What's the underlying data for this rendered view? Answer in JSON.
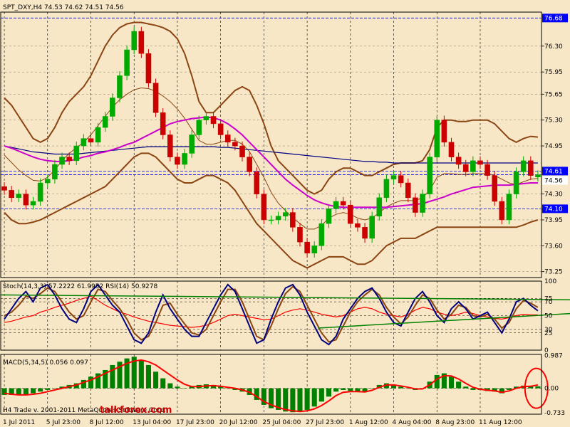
{
  "header": {
    "title": "SPT_DXY,H4  74.53 74.62 74.51 74.56",
    "stoch_label": "Stoch(14,3,3) 57.2222 61.9952  RSI(14) 50.9278",
    "macd_label": "MACD(5,34,5) 0.056 0.097",
    "copyright": "H4 Trade v. 2001-2011 MetaQuotes Software Corp.",
    "watermark": "talkforex.com"
  },
  "colors": {
    "background": "#f7e7c6",
    "frame": "#000000",
    "grid": "#000000",
    "up_candle": "#00aa00",
    "down_candle": "#cc0000",
    "bollinger": "#8b4513",
    "ma_slow": "#cc00cc",
    "ma_long": "#000080",
    "stoch_main": "#000080",
    "stoch_signal": "#8b4513",
    "rsi": "#ff0000",
    "trendline": "#008000",
    "macd_hist": "#008000",
    "macd_signal": "#ff0000",
    "price_tag": "#0000ff"
  },
  "chart_data": [
    {
      "type": "candlestick",
      "title": "SPT_DXY,H4",
      "ohlc_last": {
        "open": 74.53,
        "high": 74.62,
        "low": 74.51,
        "close": 74.56
      },
      "ylim": [
        73.17,
        76.76
      ],
      "y_ticks": [
        76.3,
        75.95,
        75.65,
        75.3,
        74.95,
        74.3,
        73.95,
        73.6,
        73.25
      ],
      "x_ticks": [
        "1 Jul 2011",
        "5 Jul 23:00",
        "8 Jul 12:00",
        "13 Jul 04:00",
        "17 Jul 23:00",
        "20 Jul 12:00",
        "25 Jul 04:00",
        "27 Jul 23:00",
        "1 Aug 12:00",
        "4 Aug 04:00",
        "8 Aug 23:00",
        "11 Aug 12:00"
      ],
      "price_tags": [
        {
          "value": "76.68"
        },
        {
          "value": "74.61"
        },
        {
          "value": "74.56"
        },
        {
          "value": "74.10"
        }
      ],
      "close": [
        74.35,
        74.25,
        74.3,
        74.15,
        74.2,
        74.45,
        74.5,
        74.7,
        74.8,
        74.75,
        74.95,
        75.05,
        75.0,
        75.2,
        75.35,
        75.6,
        75.9,
        76.25,
        76.5,
        76.2,
        75.8,
        75.4,
        75.1,
        74.8,
        74.7,
        74.85,
        75.1,
        75.3,
        75.35,
        75.25,
        75.1,
        75.0,
        74.95,
        74.8,
        74.6,
        74.3,
        73.95,
        73.95,
        74.0,
        74.05,
        73.85,
        73.65,
        73.5,
        73.6,
        73.9,
        74.1,
        74.2,
        74.15,
        73.9,
        73.85,
        73.7,
        74.0,
        74.25,
        74.5,
        74.55,
        74.45,
        74.25,
        74.05,
        74.3,
        74.8,
        75.3,
        75.0,
        74.8,
        74.7,
        74.6,
        74.75,
        74.7,
        74.55,
        74.2,
        73.95,
        74.3,
        74.6,
        74.75,
        74.55,
        74.56
      ],
      "open": [
        74.4,
        74.35,
        74.25,
        74.3,
        74.15,
        74.2,
        74.45,
        74.5,
        74.7,
        74.8,
        74.75,
        74.95,
        75.05,
        75.0,
        75.2,
        75.35,
        75.6,
        75.9,
        76.25,
        76.5,
        76.2,
        75.8,
        75.4,
        75.1,
        74.8,
        74.7,
        74.85,
        75.1,
        75.3,
        75.35,
        75.25,
        75.1,
        75.0,
        74.95,
        74.8,
        74.6,
        74.3,
        73.95,
        73.95,
        74.0,
        74.05,
        73.85,
        73.65,
        73.5,
        73.6,
        73.9,
        74.1,
        74.2,
        74.15,
        73.9,
        73.85,
        73.7,
        74.0,
        74.25,
        74.5,
        74.55,
        74.45,
        74.25,
        74.05,
        74.3,
        74.8,
        75.3,
        75.0,
        74.8,
        74.7,
        74.6,
        74.75,
        74.7,
        74.55,
        74.2,
        73.95,
        74.3,
        74.6,
        74.75,
        74.53
      ],
      "bb_upper": [
        75.6,
        75.5,
        75.35,
        75.2,
        75.05,
        75.0,
        75.05,
        75.2,
        75.4,
        75.55,
        75.65,
        75.75,
        75.9,
        76.1,
        76.3,
        76.45,
        76.55,
        76.6,
        76.62,
        76.62,
        76.6,
        76.58,
        76.55,
        76.5,
        76.4,
        76.2,
        75.9,
        75.55,
        75.4,
        75.4,
        75.5,
        75.6,
        75.7,
        75.75,
        75.7,
        75.5,
        75.25,
        74.95,
        74.75,
        74.65,
        74.55,
        74.45,
        74.35,
        74.3,
        74.35,
        74.5,
        74.6,
        74.65,
        74.65,
        74.6,
        74.55,
        74.55,
        74.6,
        74.65,
        74.7,
        74.72,
        74.72,
        74.72,
        74.75,
        74.9,
        75.2,
        75.3,
        75.3,
        75.28,
        75.28,
        75.3,
        75.3,
        75.3,
        75.25,
        75.15,
        75.05,
        75.0,
        75.05,
        75.08,
        75.07
      ],
      "bb_lower": [
        74.05,
        73.95,
        73.9,
        73.9,
        73.92,
        73.95,
        74.0,
        74.05,
        74.1,
        74.15,
        74.2,
        74.25,
        74.3,
        74.35,
        74.4,
        74.5,
        74.6,
        74.7,
        74.8,
        74.85,
        74.85,
        74.8,
        74.7,
        74.6,
        74.5,
        74.45,
        74.45,
        74.5,
        74.55,
        74.55,
        74.5,
        74.45,
        74.35,
        74.2,
        74.05,
        73.9,
        73.8,
        73.7,
        73.6,
        73.5,
        73.4,
        73.35,
        73.3,
        73.35,
        73.4,
        73.45,
        73.45,
        73.45,
        73.4,
        73.35,
        73.35,
        73.4,
        73.5,
        73.6,
        73.65,
        73.7,
        73.7,
        73.7,
        73.75,
        73.8,
        73.85,
        73.85,
        73.85,
        73.85,
        73.85,
        73.85,
        73.85,
        73.85,
        73.85,
        73.85,
        73.85,
        73.85,
        73.88,
        73.92,
        73.95
      ],
      "ma_slow": [
        74.95,
        74.92,
        74.88,
        74.84,
        74.8,
        74.77,
        74.75,
        74.74,
        74.74,
        74.75,
        74.77,
        74.8,
        74.82,
        74.85,
        74.87,
        74.9,
        74.93,
        74.97,
        75.0,
        75.05,
        75.1,
        75.15,
        75.2,
        75.25,
        75.28,
        75.3,
        75.32,
        75.33,
        75.34,
        75.33,
        75.3,
        75.25,
        75.18,
        75.1,
        75.0,
        74.9,
        74.8,
        74.7,
        74.6,
        74.5,
        74.42,
        74.35,
        74.28,
        74.22,
        74.18,
        74.15,
        74.13,
        74.12,
        74.12,
        74.12,
        74.12,
        74.12,
        74.12,
        74.12,
        74.13,
        74.14,
        74.15,
        74.16,
        74.17,
        74.2,
        74.23,
        74.26,
        74.3,
        74.33,
        74.36,
        74.39,
        74.4,
        74.41,
        74.42,
        74.42,
        74.42,
        74.43,
        74.44,
        74.45,
        74.45
      ],
      "ma_long": [
        74.95,
        74.93,
        74.91,
        74.89,
        74.87,
        74.86,
        74.85,
        74.84,
        74.84,
        74.84,
        74.84,
        74.85,
        74.86,
        74.87,
        74.88,
        74.89,
        74.9,
        74.91,
        74.92,
        74.93,
        74.94,
        74.94,
        74.94,
        74.94,
        74.94,
        74.94,
        74.94,
        74.94,
        74.94,
        74.94,
        74.93,
        74.93,
        74.92,
        74.91,
        74.9,
        74.89,
        74.88,
        74.87,
        74.86,
        74.85,
        74.84,
        74.83,
        74.82,
        74.81,
        74.8,
        74.79,
        74.78,
        74.77,
        74.76,
        74.75,
        74.74,
        74.74,
        74.73,
        74.73,
        74.72,
        74.72,
        74.72,
        74.72,
        74.72,
        74.72,
        74.72,
        74.72,
        74.72,
        74.72,
        74.72,
        74.72,
        74.72,
        74.72,
        74.72,
        74.72,
        74.72,
        74.72,
        74.72,
        74.72,
        74.72
      ]
    },
    {
      "type": "line",
      "title": "Stoch(14,3,3) 57.2222 61.9952  RSI(14) 50.9278",
      "ylim": [
        0,
        100
      ],
      "y_ticks": [
        100,
        75,
        70,
        50,
        30,
        25,
        0
      ],
      "series": [
        {
          "name": "Stoch main",
          "values": [
            45,
            60,
            75,
            85,
            70,
            90,
            95,
            80,
            60,
            45,
            40,
            60,
            85,
            95,
            80,
            65,
            55,
            35,
            15,
            10,
            25,
            55,
            80,
            60,
            45,
            30,
            20,
            20,
            40,
            60,
            80,
            95,
            85,
            60,
            35,
            10,
            15,
            45,
            70,
            90,
            95,
            80,
            55,
            35,
            15,
            8,
            20,
            45,
            60,
            75,
            85,
            90,
            75,
            55,
            40,
            35,
            55,
            75,
            85,
            70,
            50,
            40,
            60,
            70,
            60,
            45,
            50,
            55,
            40,
            25,
            45,
            70,
            75,
            65,
            57
          ]
        },
        {
          "name": "Stoch signal",
          "values": [
            50,
            55,
            65,
            78,
            75,
            82,
            90,
            85,
            70,
            55,
            45,
            50,
            70,
            88,
            85,
            72,
            60,
            45,
            25,
            15,
            20,
            40,
            65,
            68,
            52,
            38,
            25,
            22,
            30,
            50,
            70,
            88,
            88,
            70,
            45,
            20,
            15,
            35,
            60,
            82,
            92,
            85,
            65,
            45,
            25,
            12,
            15,
            35,
            55,
            70,
            80,
            88,
            80,
            62,
            48,
            38,
            48,
            65,
            80,
            75,
            58,
            45,
            52,
            65,
            62,
            50,
            48,
            52,
            45,
            32,
            40,
            60,
            72,
            68,
            62
          ]
        },
        {
          "name": "RSI",
          "values": [
            40,
            42,
            45,
            48,
            50,
            55,
            58,
            62,
            65,
            68,
            72,
            75,
            78,
            72,
            65,
            60,
            55,
            52,
            48,
            45,
            42,
            40,
            38,
            36,
            35,
            34,
            33,
            34,
            36,
            40,
            45,
            50,
            52,
            50,
            48,
            46,
            44,
            45,
            50,
            55,
            58,
            60,
            58,
            55,
            52,
            50,
            48,
            50,
            55,
            60,
            62,
            60,
            55,
            52,
            50,
            48,
            52,
            58,
            62,
            60,
            55,
            52,
            50,
            52,
            55,
            53,
            50,
            48,
            46,
            45,
            47,
            50,
            52,
            51,
            51
          ]
        }
      ],
      "trendlines": [
        {
          "from": [
            0,
            80
          ],
          "to": [
            75,
            73
          ]
        },
        {
          "from": [
            44,
            32
          ],
          "to": [
            75,
            53
          ]
        }
      ]
    },
    {
      "type": "bar",
      "title": "MACD(5,34,5) 0.056 0.097",
      "ylim": [
        -0.78,
        1.02
      ],
      "y_ticks": [
        0.987,
        0.0,
        -0.733
      ],
      "series": [
        {
          "name": "MACD",
          "values": [
            -0.2,
            -0.2,
            -0.2,
            -0.18,
            -0.15,
            -0.1,
            -0.05,
            0.0,
            0.05,
            0.1,
            0.15,
            0.25,
            0.35,
            0.45,
            0.55,
            0.7,
            0.8,
            0.9,
            0.95,
            0.85,
            0.7,
            0.5,
            0.3,
            0.15,
            0.05,
            0.0,
            0.05,
            0.1,
            0.12,
            0.1,
            0.05,
            0.0,
            -0.05,
            -0.1,
            -0.2,
            -0.35,
            -0.5,
            -0.6,
            -0.65,
            -0.7,
            -0.72,
            -0.7,
            -0.65,
            -0.55,
            -0.4,
            -0.25,
            -0.1,
            -0.05,
            -0.08,
            -0.1,
            -0.12,
            0.0,
            0.1,
            0.15,
            0.1,
            0.05,
            0.0,
            -0.05,
            0.0,
            0.2,
            0.4,
            0.45,
            0.35,
            0.2,
            0.05,
            -0.05,
            -0.05,
            -0.08,
            -0.1,
            -0.15,
            -0.05,
            0.05,
            0.08,
            0.06,
            0.06
          ]
        },
        {
          "name": "Signal",
          "values": [
            -0.15,
            -0.18,
            -0.2,
            -0.2,
            -0.18,
            -0.15,
            -0.1,
            -0.05,
            0.0,
            0.05,
            0.1,
            0.18,
            0.25,
            0.35,
            0.45,
            0.55,
            0.65,
            0.75,
            0.82,
            0.85,
            0.8,
            0.7,
            0.55,
            0.4,
            0.25,
            0.12,
            0.05,
            0.05,
            0.07,
            0.08,
            0.06,
            0.03,
            0.0,
            -0.05,
            -0.12,
            -0.25,
            -0.4,
            -0.5,
            -0.58,
            -0.64,
            -0.68,
            -0.7,
            -0.68,
            -0.62,
            -0.52,
            -0.38,
            -0.22,
            -0.12,
            -0.1,
            -0.1,
            -0.11,
            -0.06,
            0.03,
            0.1,
            0.1,
            0.07,
            0.03,
            -0.02,
            -0.02,
            0.1,
            0.28,
            0.38,
            0.37,
            0.28,
            0.15,
            0.03,
            -0.03,
            -0.06,
            -0.08,
            -0.12,
            -0.08,
            0.0,
            0.05,
            0.06,
            0.1
          ]
        }
      ]
    }
  ]
}
